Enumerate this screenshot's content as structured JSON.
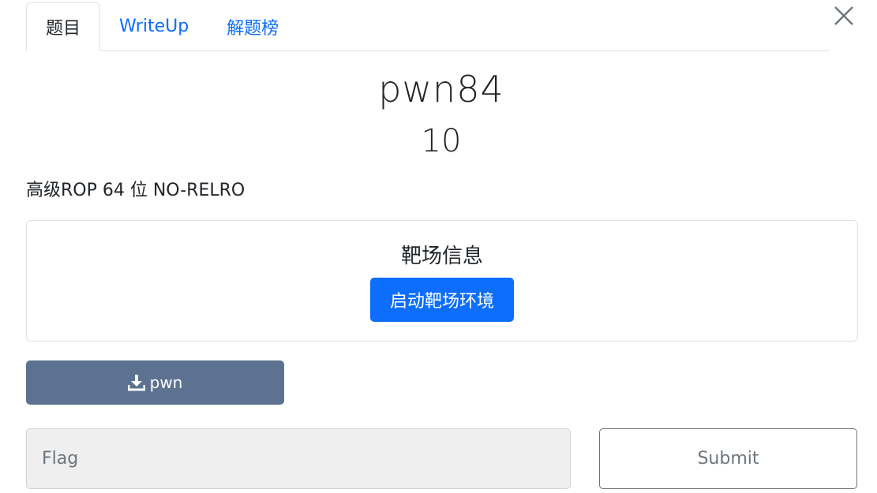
{
  "tabs": [
    {
      "label": "题目",
      "active": true
    },
    {
      "label": "WriteUp",
      "active": false
    },
    {
      "label": "解题榜",
      "active": false
    }
  ],
  "challenge": {
    "name": "pwn84",
    "value": "10",
    "description": "高级ROP 64 位 NO-RELRO"
  },
  "target": {
    "title": "靶场信息",
    "start_label": "启动靶场环境"
  },
  "download": {
    "label": "pwn",
    "icon": "download-icon"
  },
  "flag": {
    "placeholder": "Flag",
    "value": ""
  },
  "submit_label": "Submit",
  "colors": {
    "primary": "#0d6efd",
    "download_bg": "#5c7290",
    "input_bg": "#efefef",
    "muted": "#6c757d"
  }
}
